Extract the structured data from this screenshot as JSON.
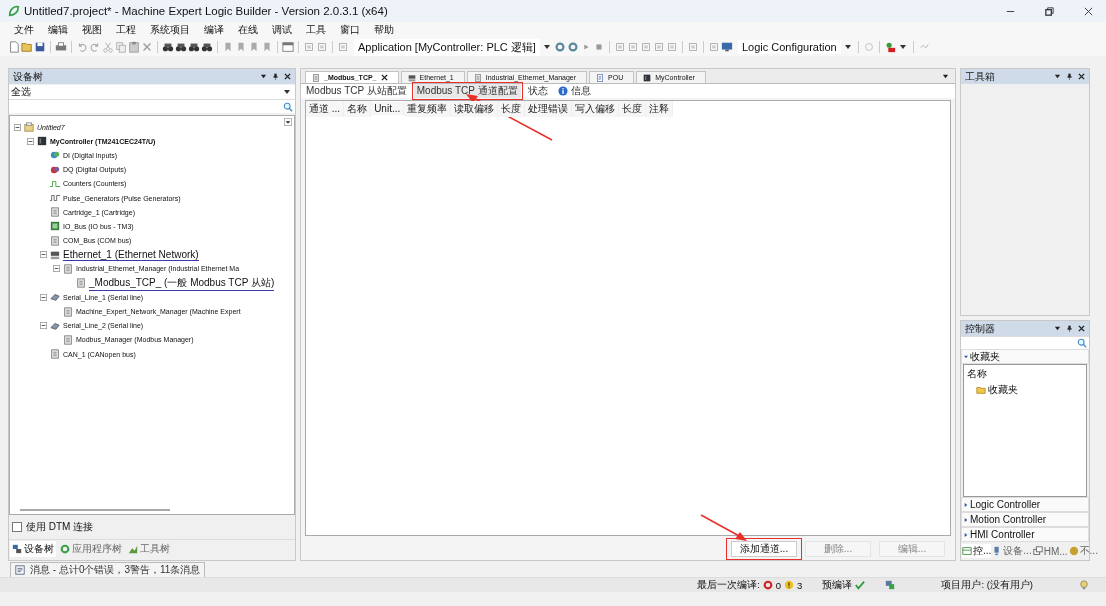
{
  "window": {
    "title": "Untitled7.project* - Machine Expert Logic Builder - Version 2.0.3.1 (x64)"
  },
  "menu": [
    "文件",
    "编辑",
    "视图",
    "工程",
    "系统项目",
    "编译",
    "在线",
    "调试",
    "工具",
    "窗口",
    "帮助"
  ],
  "toolbar": {
    "application": "Application [MyController: PLC 逻辑]",
    "configuration": "Logic Configuration"
  },
  "device_tree": {
    "title": "设备树",
    "filter": "全选",
    "items": [
      {
        "label": "Untitled7",
        "kind": "project",
        "expanded": true,
        "highlighted": false,
        "children": [
          {
            "label": "MyController (TM241CEC24T/U)",
            "kind": "controller",
            "expanded": true,
            "highlighted": false,
            "children": [
              {
                "label": "DI (Digital Inputs)",
                "kind": "di",
                "highlighted": false
              },
              {
                "label": "DQ (Digital Outputs)",
                "kind": "dq",
                "highlighted": false
              },
              {
                "label": "Counters (Counters)",
                "kind": "counter",
                "highlighted": false
              },
              {
                "label": "Pulse_Generators (Pulse Generators)",
                "kind": "pulse",
                "highlighted": false
              },
              {
                "label": "Cartridge_1 (Cartridge)",
                "kind": "module",
                "highlighted": false
              },
              {
                "label": "IO_Bus (IO bus - TM3)",
                "kind": "iobus",
                "highlighted": false
              },
              {
                "label": "COM_Bus (COM bus)",
                "kind": "module",
                "highlighted": false
              },
              {
                "label": "Ethernet_1 (Ethernet Network)",
                "kind": "network",
                "expanded": true,
                "highlighted": true,
                "children": [
                  {
                    "label": "Industrial_Ethernet_Manager (Industrial Ethernet Ma",
                    "kind": "module",
                    "expanded": true,
                    "highlighted": false,
                    "children": [
                      {
                        "label": "_Modbus_TCP_ (一般 Modbus TCP 从站)",
                        "kind": "module",
                        "highlighted": true
                      }
                    ]
                  }
                ]
              },
              {
                "label": "Serial_Line_1 (Serial line)",
                "kind": "serial",
                "expanded": true,
                "highlighted": false,
                "children": [
                  {
                    "label": "Machine_Expert_Network_Manager (Machine Expert",
                    "kind": "module",
                    "highlighted": false
                  }
                ]
              },
              {
                "label": "Serial_Line_2 (Serial line)",
                "kind": "serial",
                "expanded": true,
                "highlighted": false,
                "children": [
                  {
                    "label": "Modbus_Manager (Modbus Manager)",
                    "kind": "module",
                    "highlighted": false
                  }
                ]
              },
              {
                "label": "CAN_1 (CANopen bus)",
                "kind": "module",
                "highlighted": false
              }
            ]
          }
        ]
      }
    ],
    "use_dtm": {
      "label": "使用 DTM 连接",
      "checked": false
    },
    "tabs": [
      {
        "label": "设备树",
        "kind": "devices",
        "selected": true
      },
      {
        "label": "应用程序树",
        "kind": "application",
        "selected": false
      },
      {
        "label": "工具树",
        "kind": "tools",
        "selected": false
      }
    ]
  },
  "editor": {
    "tabs": [
      {
        "label": "_Modbus_TCP_",
        "kind": "module",
        "selected": true
      },
      {
        "label": "Ethernet_1",
        "kind": "network",
        "selected": false
      },
      {
        "label": "Industrial_Ethernet_Manager",
        "kind": "module",
        "selected": false
      },
      {
        "label": "POU",
        "kind": "pou",
        "selected": false
      },
      {
        "label": "MyController",
        "kind": "controller",
        "selected": false
      }
    ],
    "subtabs": [
      {
        "label": "Modbus TCP 从站配置",
        "kind": "plain",
        "selected": false,
        "annotated": false
      },
      {
        "label": "Modbus TCP 通道配置",
        "kind": "plain",
        "selected": true,
        "annotated": true
      },
      {
        "label": "状态",
        "kind": "plain",
        "selected": false,
        "annotated": false
      },
      {
        "label": "信息",
        "kind": "info",
        "selected": false,
        "annotated": false
      }
    ],
    "table": {
      "columns": [
        "通道 ...",
        "名称",
        "Unit...",
        "重复频率",
        "读取偏移",
        "长度",
        "处理错误",
        "写入偏移",
        "长度",
        "注释"
      ]
    },
    "buttons": [
      {
        "label": "添加通道...",
        "disabled": false,
        "annotated": true
      },
      {
        "label": "删除...",
        "disabled": true,
        "annotated": false
      },
      {
        "label": "编辑...",
        "disabled": true,
        "annotated": false
      }
    ]
  },
  "toolbox": {
    "title": "工具箱"
  },
  "controllers": {
    "title": "控制器",
    "sections": [
      {
        "label": "收藏夹",
        "expanded": true,
        "list_header": "名称",
        "items": [
          "收藏夹"
        ]
      },
      {
        "label": "Logic Controller",
        "expanded": false
      },
      {
        "label": "Motion Controller",
        "expanded": false
      },
      {
        "label": "HMI Controller",
        "expanded": false
      }
    ],
    "tabs": [
      {
        "label": "控...",
        "kind": "controller",
        "selected": true
      },
      {
        "label": "设备...",
        "kind": "device",
        "selected": false
      },
      {
        "label": "HM...",
        "kind": "hmi",
        "selected": false
      },
      {
        "label": "不...",
        "kind": "misc",
        "selected": false
      }
    ]
  },
  "messages": {
    "label": "消息 - 总计0个错误，3警告，11条消息"
  },
  "status_bar": {
    "last_build": "最后一次编译:",
    "errors": "0",
    "warnings": "3",
    "precompile": "预编译",
    "precompile_ok": true,
    "user": "项目用户: (没有用户)"
  }
}
